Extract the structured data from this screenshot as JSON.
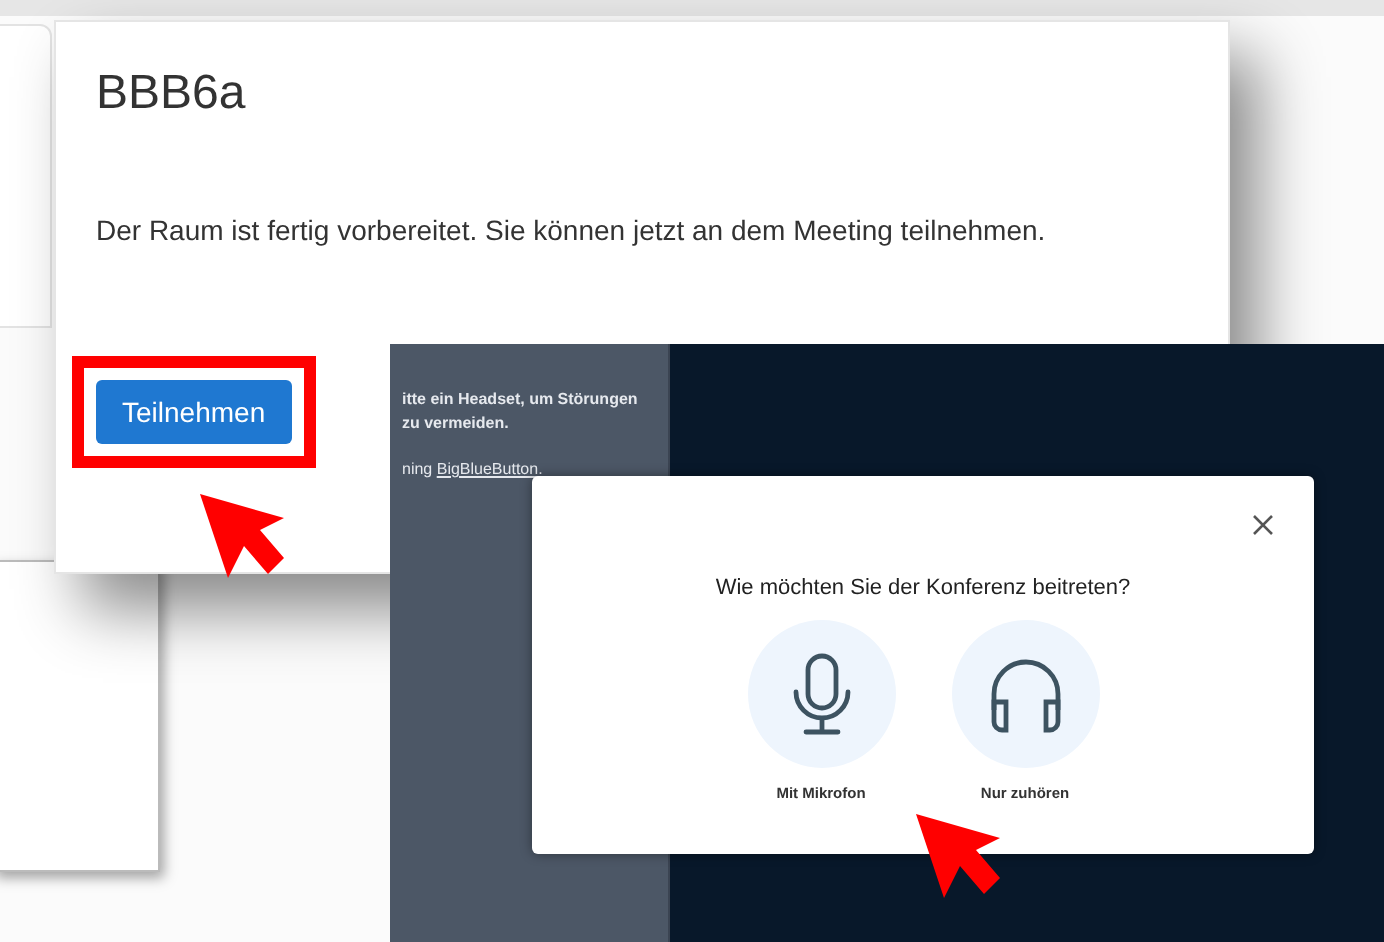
{
  "dialog": {
    "title": "BBB6a",
    "message": "Der Raum ist fertig vorbereitet. Sie können jetzt an dem Meeting teilnehmen.",
    "button": "Teilnehmen",
    "highlighted": true
  },
  "conference": {
    "side_text": [
      "itte ein Headset, um Störungen",
      "zu vermeiden."
    ],
    "side_link_prefix": "ning",
    "side_link": "BigBlueButton.",
    "question": "Wie möchten Sie der Konferenz beitreten?",
    "options": [
      {
        "kind": "microphone",
        "label": "Mit Mikrofon"
      },
      {
        "kind": "headphones",
        "label": "Nur zuhören"
      }
    ]
  }
}
